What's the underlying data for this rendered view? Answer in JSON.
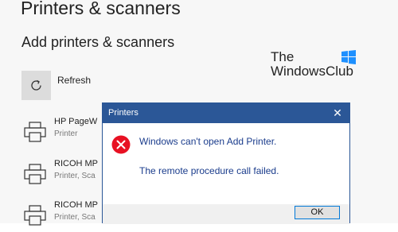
{
  "settings": {
    "page_title": "Printers & scanners",
    "section_title": "Add printers & scanners",
    "refresh_label": "Refresh",
    "printers": [
      {
        "name": "HP PageW",
        "status": "Printer"
      },
      {
        "name": "RICOH MP",
        "status": "Printer, Sca"
      },
      {
        "name": "RICOH MP",
        "status": "Printer, Sca"
      }
    ]
  },
  "watermark": {
    "line1": "The",
    "line2": "WindowsClub",
    "logo_color": "#1e90ff"
  },
  "dialog": {
    "title": "Printers",
    "close_glyph": "✕",
    "message_primary": "Windows can't open Add Printer.",
    "message_secondary": "The remote procedure call failed.",
    "ok_label": "OK",
    "icon": "error-icon",
    "titlebar_color": "#2b5797",
    "error_color": "#e81123"
  }
}
